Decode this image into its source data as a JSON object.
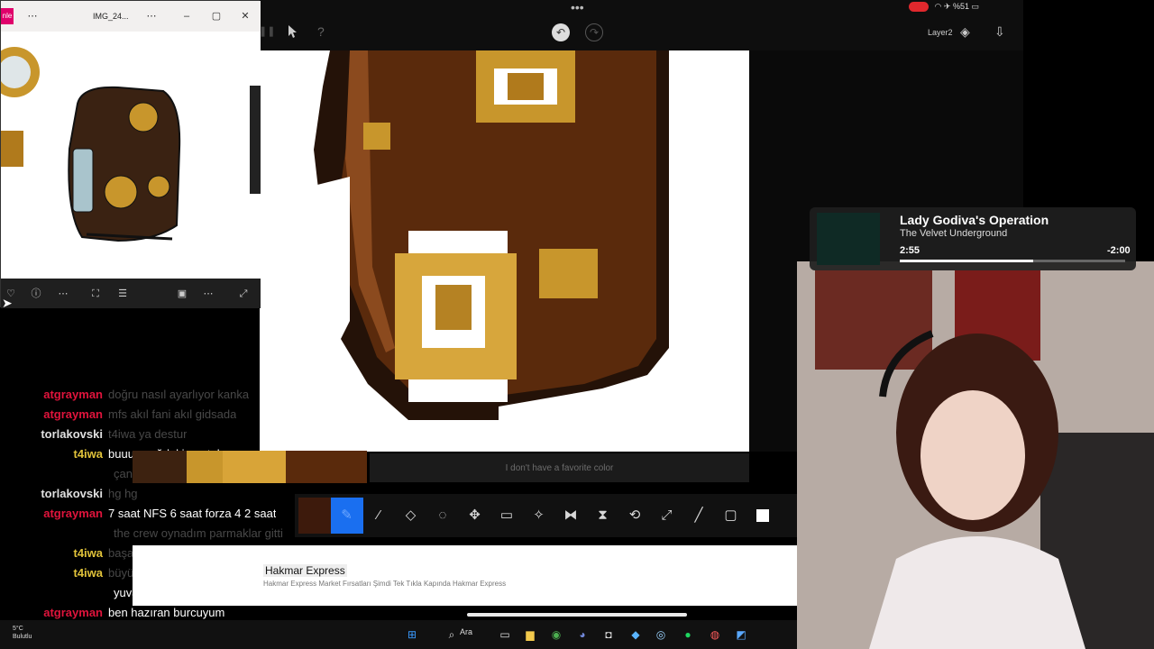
{
  "photos_window": {
    "title": "IMG_24...",
    "app_badge": "nle",
    "icons": [
      "more-icon",
      "minimize-icon",
      "maximize-icon",
      "close-icon"
    ]
  },
  "chat": {
    "messages": [
      {
        "user": "atgrayman",
        "text": "doğru nasıl ayarlıyor kanka",
        "user_color": "#e0143c",
        "faded": true
      },
      {
        "user": "atgrayman",
        "text": "mfs akıl fani akıl gidsada",
        "user_color": "#e0143c",
        "faded": true
      },
      {
        "user": "torlakovski",
        "text": "t4iwa ya destur",
        "user_color": "#e0e0e0",
        "faded": true
      },
      {
        "user": "t4iwa",
        "text": "buuuu sağdaki sarıtokanın adı ne",
        "user_color": "#e0c23a",
        "faded": false
      },
      {
        "user": "",
        "text": "çantaki o madalyon gibi şeyler",
        "user_color": "#e0c23a",
        "faded": true
      },
      {
        "user": "torlakovski",
        "text": "hg hg",
        "user_color": "#e0e0e0",
        "faded": true
      },
      {
        "user": "atgrayman",
        "text": "7 saat NFS 6 saat forza 4 2 saat",
        "user_color": "#e0143c",
        "faded": false
      },
      {
        "user": "",
        "text": "the crew oynadım parmaklar gitti",
        "user_color": "#e0143c",
        "faded": true
      },
      {
        "user": "t4iwa",
        "text": "başak yükselenim var şekil",
        "user_color": "#e0c23a",
        "faded": true
      },
      {
        "user": "t4iwa",
        "text": "büyük yuvarlağın sağındaki küçük",
        "user_color": "#e0c23a",
        "faded": true
      },
      {
        "user": "",
        "text": "yuvarlak",
        "user_color": "#e0c23a",
        "faded": false
      },
      {
        "user": "atgrayman",
        "text": "ben hazıran burcuyum",
        "user_color": "#e0143c",
        "faded": false
      }
    ]
  },
  "drawing_app": {
    "layer_label": "Layer2",
    "favorite_color_text": "I don't have a favorite color",
    "tools": [
      "color-swatch",
      "pencil",
      "eyedropper",
      "eraser",
      "lasso",
      "move",
      "select-rect",
      "magic-wand",
      "flip",
      "fill",
      "transform",
      "fullscreen",
      "line",
      "rectangle",
      "white-swatch"
    ],
    "colors": {
      "active": "#1a6ff0",
      "selected_color": "#3d1a0c"
    }
  },
  "ad": {
    "title": "Hakmar Express",
    "subtitle": "Hakmar Express Market Fırsatları Şimdi Tek Tıkla Kapında Hakmar Express"
  },
  "status_bar": {
    "text": "%51"
  },
  "music": {
    "title": "Lady Godiva's Operation",
    "artist": "The Velvet Underground",
    "elapsed": "2:55",
    "remaining": "-2:00",
    "progress": 0.59
  },
  "taskbar": {
    "weather_temp": "5°C",
    "weather_text": "Bulutlu",
    "search_label": "Ara"
  }
}
